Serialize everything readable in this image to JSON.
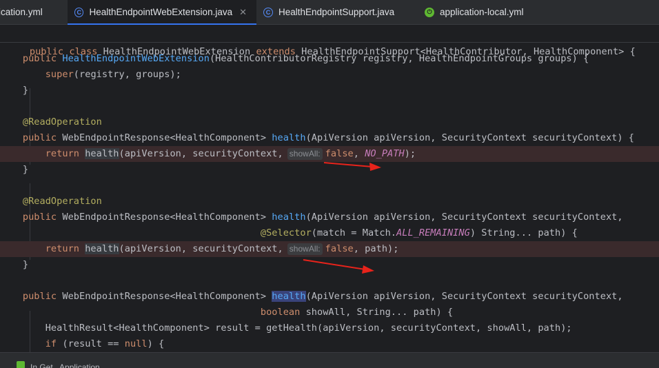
{
  "tabs": [
    {
      "label": "ication.yml",
      "icon": "none"
    },
    {
      "label": "HealthEndpointWebExtension.java",
      "icon": "java-class-icon",
      "active": true
    },
    {
      "label": "HealthEndpointSupport.java",
      "icon": "java-class-icon"
    },
    {
      "label": "application-local.yml",
      "icon": "spring-config-icon"
    }
  ],
  "sticky_header": {
    "kw1": "public class ",
    "name": "HealthEndpointWebExtension ",
    "kw2": "extends ",
    "rest": "HealthEndpointSupport<HealthContributor, HealthComponent> {"
  },
  "code": {
    "l1": {
      "kw": "public ",
      "fn": "HealthEndpointWebExtension",
      "rest": "(HealthContributorRegistry registry, HealthEndpointGroups groups) {"
    },
    "l2": {
      "kw": "super",
      "rest": "(registry, groups);"
    },
    "l3": "}",
    "l5": "@ReadOperation",
    "l6": {
      "kw": "public ",
      "type": "WebEndpointResponse<HealthComponent> ",
      "fn": "health",
      "rest": "(ApiVersion apiVersion, SecurityContext securityContext) {"
    },
    "l7": {
      "kw": "return ",
      "call": "health",
      "args": "(apiVersion, securityContext,",
      "hint": "showAll:",
      "kw2": "false",
      "sep": ", ",
      "cst": "NO_PATH",
      "end": ");"
    },
    "l8": "}",
    "l10": "@ReadOperation",
    "l11": {
      "kw": "public ",
      "type": "WebEndpointResponse<HealthComponent> ",
      "fn": "health",
      "rest": "(ApiVersion apiVersion, SecurityContext securityContext,"
    },
    "l12": {
      "ann": "@Selector",
      "a": "(match = Match.",
      "cst": "ALL_REMAINING",
      "b": ") String... path) {"
    },
    "l13": {
      "kw": "return ",
      "call": "health",
      "args": "(apiVersion, securityContext,",
      "hint": "showAll:",
      "kw2": "false",
      "end": ", path);"
    },
    "l14": "}",
    "l16": {
      "kw": "public ",
      "type": "WebEndpointResponse<HealthComponent> ",
      "fn": "health",
      "rest": "(ApiVersion apiVersion, SecurityContext securityContext,"
    },
    "l17": {
      "kw": "boolean ",
      "rest": "showAll, String... path) {"
    },
    "l18": "HealthResult<HealthComponent> result = getHealth(apiVersion, securityContext, showAll, path);",
    "l19": {
      "kw": "if ",
      "a": "(result == ",
      "kw2": "null",
      "b": ") {"
    }
  },
  "status": {
    "text": "In Get..  Application  ..."
  },
  "colors": {
    "keyword": "#cf8e6d",
    "method": "#56a8f5",
    "annotation": "#b3ae60",
    "constant": "#c77dbb",
    "text": "#bcbec4",
    "highlight_line": "#3a2a2c",
    "arrow": "#e8231b"
  }
}
